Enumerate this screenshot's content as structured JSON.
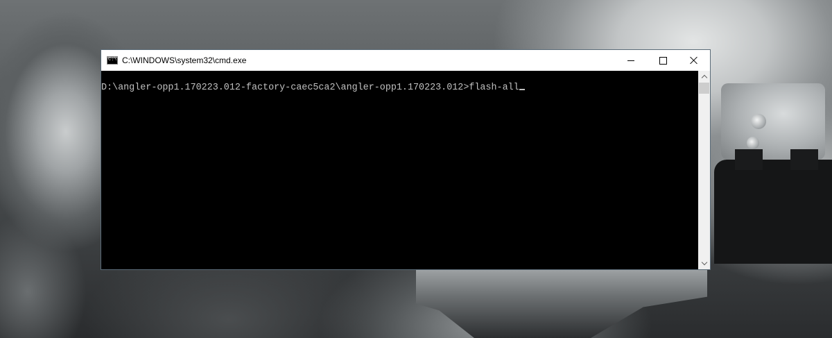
{
  "window": {
    "title": "C:\\WINDOWS\\system32\\cmd.exe",
    "app_icon_label": "C:\\",
    "controls": {
      "minimize": "minimize-icon",
      "maximize": "maximize-icon",
      "close": "close-icon"
    }
  },
  "console": {
    "prompt": "D:\\angler-opp1.170223.012-factory-caec5ca2\\angler-opp1.170223.012>",
    "command": "flash-all"
  },
  "colors": {
    "console_background": "#000000",
    "console_text": "#c0c0c0",
    "titlebar": "#ffffff"
  }
}
